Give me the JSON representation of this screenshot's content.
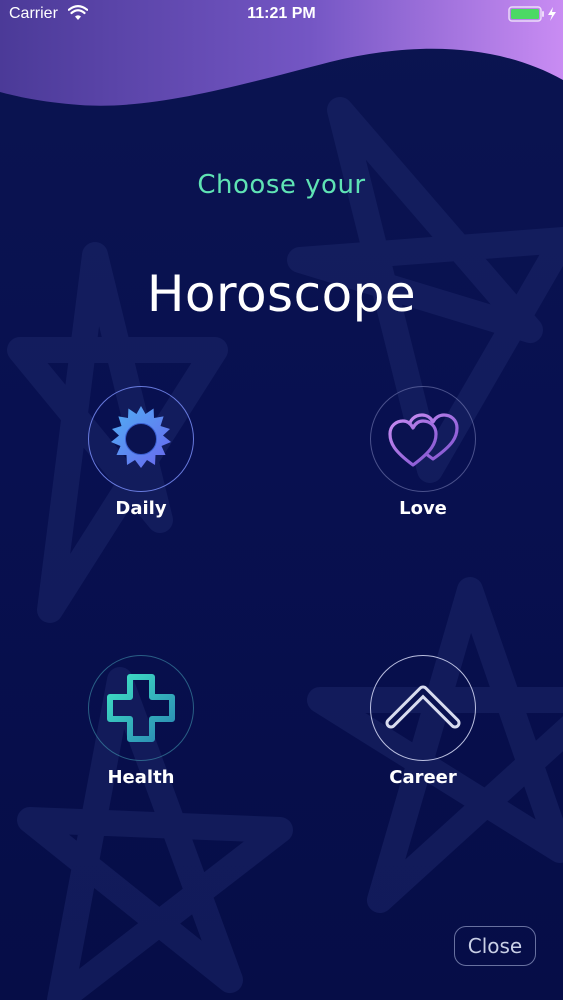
{
  "status_bar": {
    "carrier": "Carrier",
    "time": "11:21 PM",
    "wifi_icon": "wifi-icon",
    "battery_icon": "battery-charging-icon",
    "battery_level": 1.0,
    "battery_color": "#4cd964"
  },
  "header": {
    "subtitle": "Choose your",
    "title": "Horoscope"
  },
  "categories": [
    {
      "label": "Daily",
      "icon": "sun-icon"
    },
    {
      "label": "Love",
      "icon": "hearts-icon"
    },
    {
      "label": "Health",
      "icon": "health-cross-icon"
    },
    {
      "label": "Career",
      "icon": "chevron-up-icon"
    }
  ],
  "close_button": {
    "label": "Close"
  },
  "colors": {
    "background": "#060c44",
    "accent_teal": "#5fe3b4",
    "wave_gradient_start": "#4e3c9c",
    "wave_gradient_end": "#c88cf2"
  }
}
